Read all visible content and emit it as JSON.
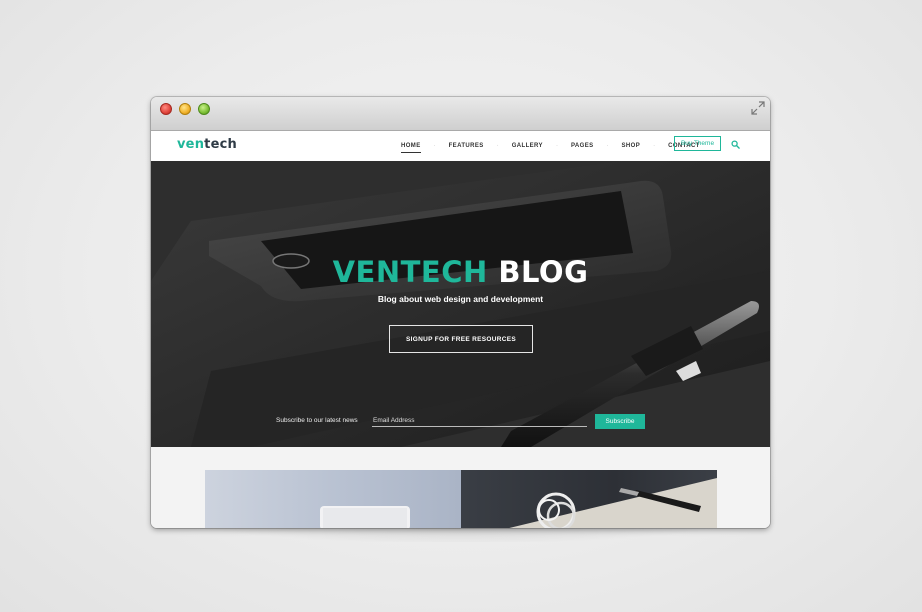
{
  "logo": {
    "part1": "ven",
    "part2": "tech"
  },
  "nav": {
    "items": [
      "HOME",
      "FEATURES",
      "GALLERY",
      "PAGES",
      "SHOP",
      "CONTACT"
    ],
    "separator": "·",
    "buy_label": "Buy Theme",
    "search_icon": "search-icon"
  },
  "hero": {
    "title_accent": "VENTECH",
    "title_rest": "BLOG",
    "subtitle": "Blog about web design and development",
    "cta_label": "SIGNUP FOR FREE RESOURCES"
  },
  "newsletter": {
    "label": "Subscribe to our latest news",
    "placeholder": "Email Address",
    "button_label": "Subscribe"
  },
  "colors": {
    "accent": "#1fb79a",
    "dark": "#2f3b46"
  }
}
